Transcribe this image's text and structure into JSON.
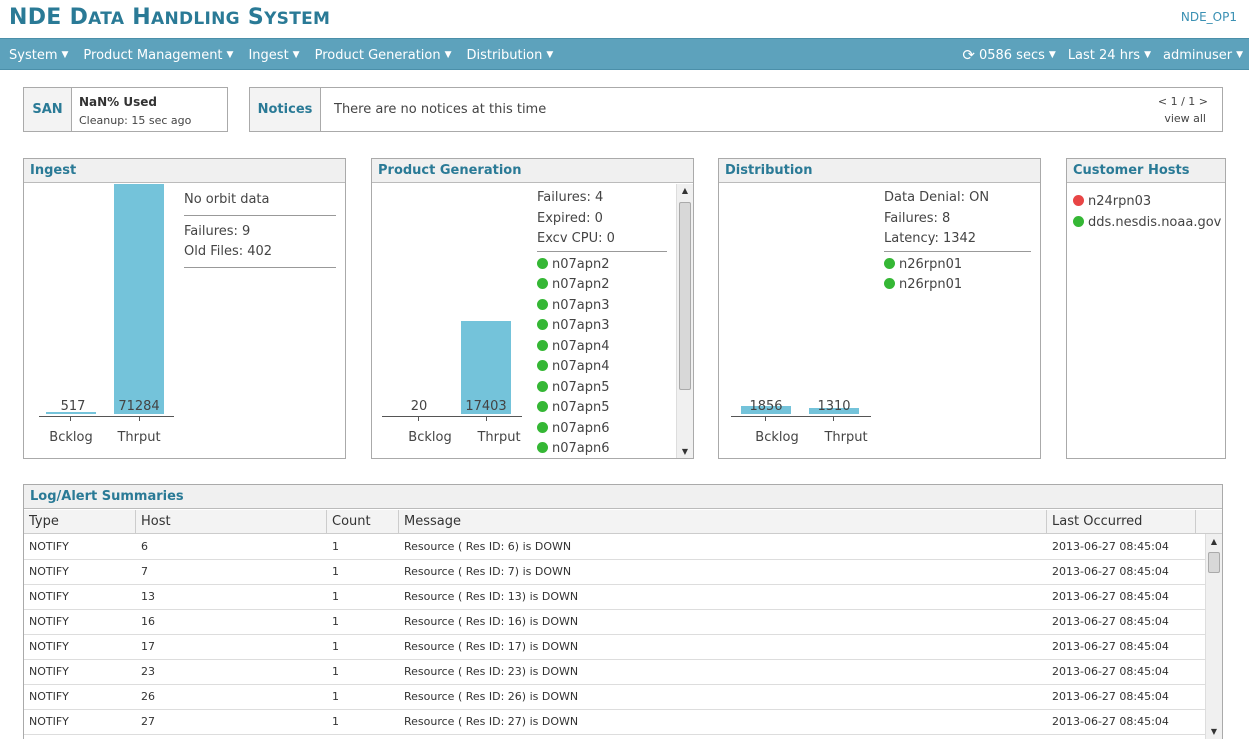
{
  "header": {
    "title_first": "NDE",
    "title_rest_big": [
      "D",
      "H",
      "S"
    ],
    "title_words": [
      "ATA",
      "ANDLING",
      "YSTEM"
    ],
    "server": "NDE_OP1"
  },
  "nav": {
    "left": [
      "System",
      "Product Management",
      "Ingest",
      "Product Generation",
      "Distribution"
    ],
    "refresh": "0586 secs",
    "range": "Last 24 hrs",
    "user": "adminuser"
  },
  "san": {
    "label": "SAN",
    "used": "NaN% Used",
    "cleanup": "Cleanup: 15 sec ago"
  },
  "notices": {
    "label": "Notices",
    "message": "There are no notices at this time",
    "pager": "< 1 / 1 >",
    "view_all": "view all"
  },
  "ingest": {
    "title": "Ingest",
    "backlog_value": "517",
    "throughput_value": "71284",
    "backlog_label": "Bcklog",
    "throughput_label": "Thrput",
    "orbit": "No orbit data",
    "failures": "Failures: 9",
    "old_files": "Old Files: 402"
  },
  "product_generation": {
    "title": "Product Generation",
    "backlog_value": "20",
    "throughput_value": "17403",
    "backlog_label": "Bcklog",
    "throughput_label": "Thrput",
    "failures": "Failures: 4",
    "expired": "Expired: 0",
    "excv_cpu": "Excv CPU: 0",
    "hosts": [
      "n07apn2",
      "n07apn2",
      "n07apn3",
      "n07apn3",
      "n07apn4",
      "n07apn4",
      "n07apn5",
      "n07apn5",
      "n07apn6",
      "n07apn6"
    ]
  },
  "distribution": {
    "title": "Distribution",
    "backlog_value": "1856",
    "throughput_value": "1310",
    "backlog_label": "Bcklog",
    "throughput_label": "Thrput",
    "data_denial": "Data Denial: ON",
    "failures": "Failures: 8",
    "latency": "Latency: 1342",
    "hosts": [
      "n26rpn01",
      "n26rpn01"
    ]
  },
  "customer_hosts": {
    "title": "Customer Hosts",
    "hosts": [
      {
        "name": "n24rpn03",
        "status": "down"
      },
      {
        "name": "dds.nesdis.noaa.gov",
        "status": "up"
      }
    ]
  },
  "log": {
    "title": "Log/Alert Summaries",
    "columns": [
      "Type",
      "Host",
      "Count",
      "Message",
      "Last Occurred"
    ],
    "rows": [
      [
        "NOTIFY",
        "6",
        "1",
        "Resource ( Res ID: 6) is DOWN",
        "2013-06-27 08:45:04"
      ],
      [
        "NOTIFY",
        "7",
        "1",
        "Resource ( Res ID: 7) is DOWN",
        "2013-06-27 08:45:04"
      ],
      [
        "NOTIFY",
        "13",
        "1",
        "Resource ( Res ID: 13) is DOWN",
        "2013-06-27 08:45:04"
      ],
      [
        "NOTIFY",
        "16",
        "1",
        "Resource ( Res ID: 16) is DOWN",
        "2013-06-27 08:45:04"
      ],
      [
        "NOTIFY",
        "17",
        "1",
        "Resource ( Res ID: 17) is DOWN",
        "2013-06-27 08:45:04"
      ],
      [
        "NOTIFY",
        "23",
        "1",
        "Resource ( Res ID: 23) is DOWN",
        "2013-06-27 08:45:04"
      ],
      [
        "NOTIFY",
        "26",
        "1",
        "Resource ( Res ID: 26) is DOWN",
        "2013-06-27 08:45:04"
      ],
      [
        "NOTIFY",
        "27",
        "1",
        "Resource ( Res ID: 27) is DOWN",
        "2013-06-27 08:45:04"
      ]
    ]
  },
  "colors": {
    "accent": "#2a7a96",
    "navbar": "#5da2bc",
    "bar": "#74c3da",
    "status_up": "#35b735",
    "status_down": "#e84545"
  }
}
